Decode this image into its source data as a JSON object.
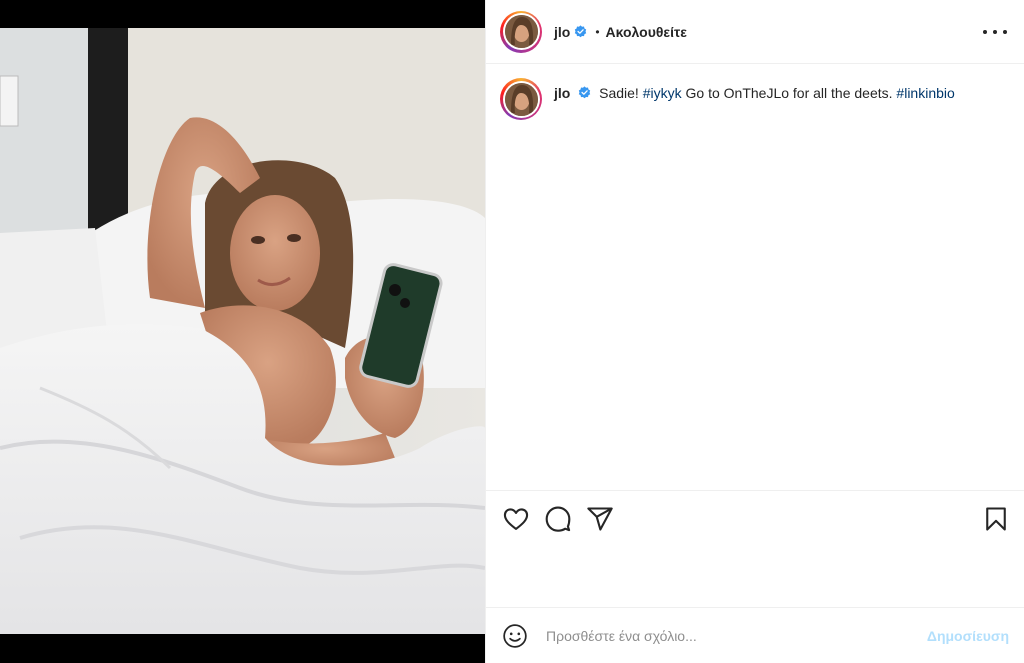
{
  "post": {
    "author": {
      "username": "jlo",
      "verified": true,
      "avatar": "profile-photo"
    },
    "follow_status": "Ακολουθείτε",
    "separator": "•",
    "caption": {
      "username": "jlo",
      "text_1": "Sadie! ",
      "hashtag_1": "#iykyk",
      "text_2": " Go to OnTheJLo for all the deets. ",
      "hashtag_2": "#linkinbio"
    },
    "media": {
      "description_icon": "photo-woman-in-bed-with-phone"
    },
    "actions": {
      "like_icon": "heart-icon",
      "comment_icon": "comment-bubble-icon",
      "share_icon": "paper-plane-icon",
      "save_icon": "bookmark-icon"
    },
    "comment_box": {
      "placeholder": "Προσθέστε ένα σχόλιο...",
      "publish_label": "Δημοσίευση"
    }
  },
  "colors": {
    "verified_blue": "#3897f0",
    "hashtag_blue": "#00376b",
    "publish_disabled": "#b2dffc",
    "divider": "#efefef"
  }
}
